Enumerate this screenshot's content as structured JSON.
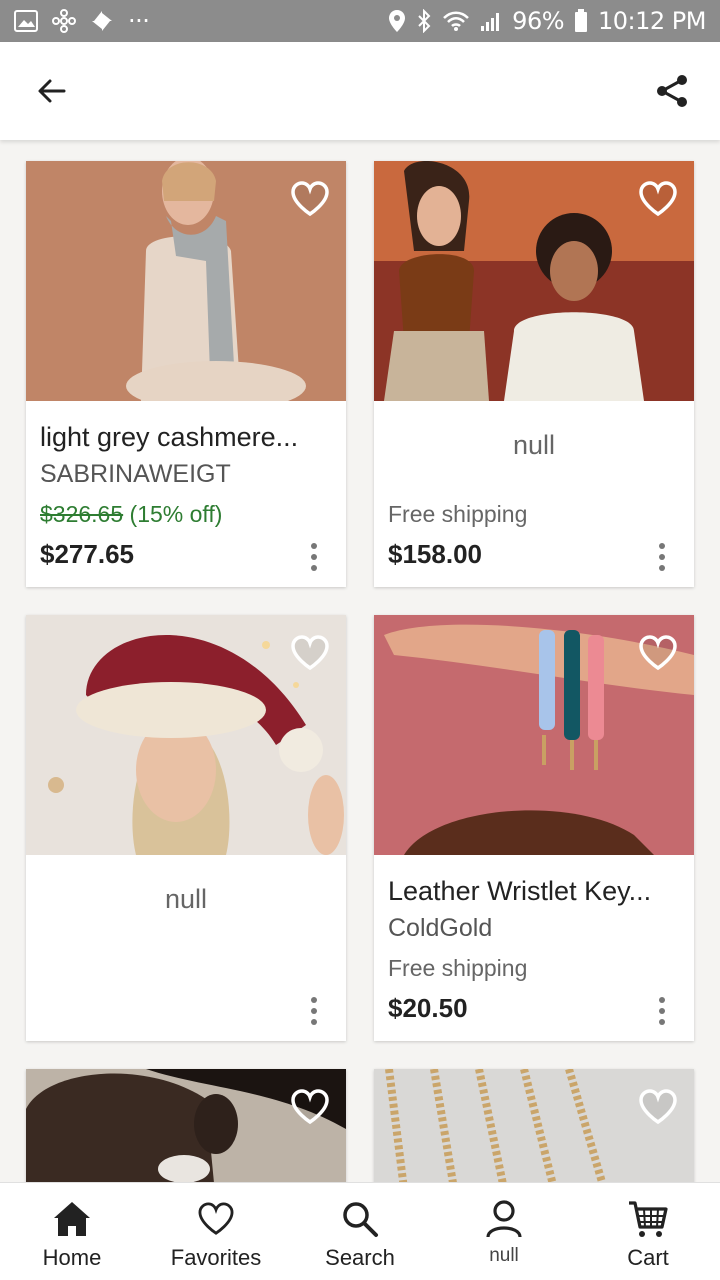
{
  "status_bar": {
    "battery": "96%",
    "time": "10:12 PM",
    "more": "···"
  },
  "app_bar": {
    "back_icon": "back-arrow-icon",
    "share_icon": "share-icon"
  },
  "products": [
    {
      "title": "light grey cashmere...",
      "shop": "SABRINAWEIGT",
      "original_price": "$326.65",
      "discount": "(15% off)",
      "price": "$277.65",
      "image_colors": [
        "#c08567",
        "#e6d6c8"
      ]
    },
    {
      "title": "null",
      "shipping": "Free shipping",
      "price": "$158.00",
      "image_colors": [
        "#c9693e",
        "#8c3426"
      ]
    },
    {
      "title": "null",
      "image_colors": [
        "#e8e2dc",
        "#8c1f2c"
      ]
    },
    {
      "title": "Leather Wristlet Key...",
      "shop": "ColdGold",
      "shipping": "Free shipping",
      "price": "$20.50",
      "image_colors": [
        "#c56a6e",
        "#e79a98"
      ]
    },
    {
      "image_colors": [
        "#bdb3a7",
        "#3a2a22"
      ]
    },
    {
      "image_colors": [
        "#d9d8d6",
        "#caa56a"
      ]
    }
  ],
  "bottom_nav": [
    {
      "label": "Home",
      "icon": "home-icon"
    },
    {
      "label": "Favorites",
      "icon": "heart-icon"
    },
    {
      "label": "Search",
      "icon": "search-icon"
    },
    {
      "label": "null",
      "icon": "profile-icon"
    },
    {
      "label": "Cart",
      "icon": "cart-icon"
    }
  ],
  "colors": {
    "status_bar": "#8c8c8c",
    "discount_green": "#2e7d32",
    "background": "#f5f4f2"
  }
}
